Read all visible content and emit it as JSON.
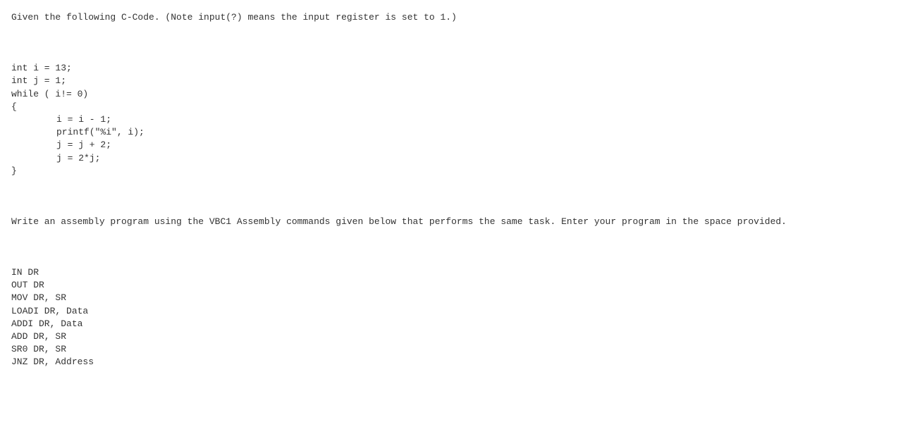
{
  "intro": "Given the following C-Code. (Note input(?) means the input register is set to 1.)",
  "code": {
    "line1": "int i = 13;",
    "line2": "int j = 1;",
    "line3": "while ( i!= 0)",
    "line4": "{",
    "line5": "i = i - 1;",
    "line6": "printf(\"%i\", i);",
    "line7": "j = j + 2;",
    "line8": "j = 2*j;",
    "line9": "}"
  },
  "instruction": "Write an assembly program using the VBC1 Assembly commands given below that performs the same task. Enter your program in the space provided.",
  "asm": {
    "line1": "IN DR",
    "line2": "OUT DR",
    "line3": "MOV DR, SR",
    "line4": "LOADI DR, Data",
    "line5": "ADDI DR, Data",
    "line6": "ADD DR, SR",
    "line7": "SR0 DR, SR",
    "line8": "JNZ DR, Address"
  }
}
